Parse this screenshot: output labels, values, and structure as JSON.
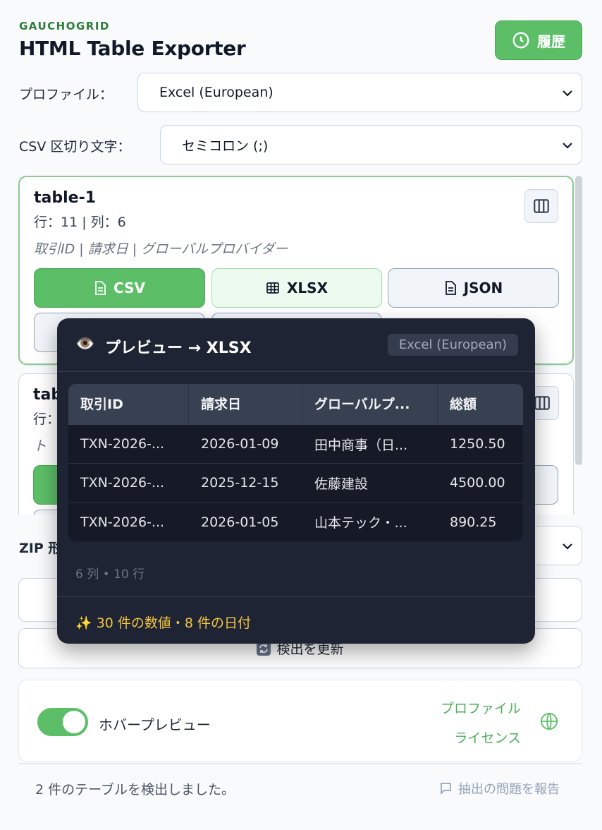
{
  "header": {
    "brand": "GAUCHOGRID",
    "title": "HTML Table Exporter",
    "history_label": "履歴"
  },
  "profile": {
    "label": "プロファイル：",
    "selected": "Excel (European)"
  },
  "csv": {
    "label": "CSV 区切り文字：",
    "selected": "セミコロン (;)"
  },
  "tables": [
    {
      "name": "table-1",
      "meta": "行：11 | 列：6",
      "columns_preview": "取引ID | 請求日 | グローバルプロバイダー",
      "formats": [
        "CSV",
        "XLSX",
        "JSON"
      ]
    },
    {
      "name": "tab",
      "meta": "行：",
      "columns_preview": "ト"
    }
  ],
  "zip": {
    "label": "ZIP 形"
  },
  "refresh_label": "検出を更新",
  "settings": {
    "hover_preview_label": "ホバープレビュー",
    "profile_link": "プロファイル",
    "license_link": "ライセンス"
  },
  "footer": {
    "status": "2 件のテーブルを検出しました。",
    "report": "抽出の問題を報告"
  },
  "tooltip": {
    "eye": "👁️",
    "title": "プレビュー → XLSX",
    "badge": "Excel (European)",
    "columns": [
      "取引ID",
      "請求日",
      "グローバルプ...",
      "総額"
    ],
    "rows": [
      [
        "TXN-2026-...",
        "2026-01-09",
        "田中商事（日...",
        "1250.50"
      ],
      [
        "TXN-2026-...",
        "2025-12-15",
        "佐藤建設",
        "4500.00"
      ],
      [
        "TXN-2026-...",
        "2026-01-05",
        "山本テック・...",
        "890.25"
      ]
    ],
    "footnote": "6 列 • 10 行",
    "summary": "✨ 30 件の数値・8 件の日付"
  },
  "colors": {
    "accent": "#5cbf68",
    "tooltip_bg": "#1e2433",
    "summary": "#f4c542"
  }
}
